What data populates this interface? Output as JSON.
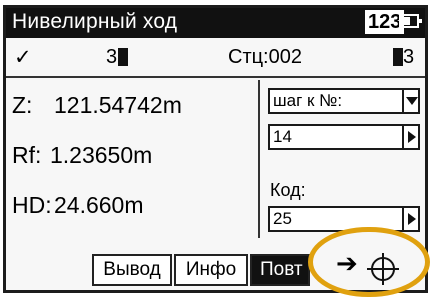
{
  "titlebar": {
    "title": "Нивелирный ход",
    "mode": "123",
    "battery_icon": "battery-icon"
  },
  "status": {
    "check_icon": "✓",
    "point_prefix": "3",
    "station": "Стц:002",
    "rf_count": "3"
  },
  "measurements": {
    "z_label": "Z:",
    "z_value": "121.54742m",
    "rf_label": "Rf:",
    "rf_value": "1.23650m",
    "hd_label": "HD:",
    "hd_value": "24.660m"
  },
  "right_panel": {
    "step_select": "шаг к №:",
    "step_value": "14",
    "code_label": "Код:",
    "code_value": "25"
  },
  "softkeys": {
    "output": "Вывод",
    "info": "Инфо",
    "repeat": "Повт",
    "arrow": "➔"
  },
  "colors": {
    "highlight_ring": "#e0a10f",
    "titlebar_bg": "#111111"
  }
}
